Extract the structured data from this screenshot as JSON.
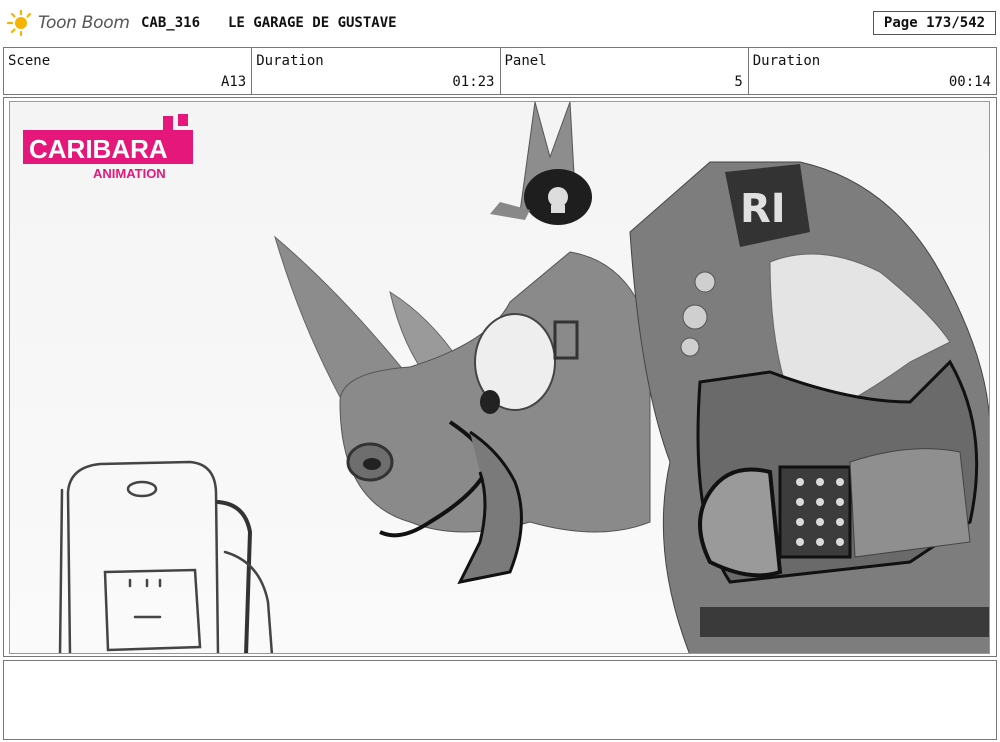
{
  "header": {
    "app_name": "Toon Boom",
    "project_code": "CAB_316",
    "title": "LE GARAGE DE GUSTAVE",
    "page": "Page 173/542"
  },
  "info": {
    "scene_label": "Scene",
    "scene_value": "A13",
    "duration1_label": "Duration",
    "duration1_value": "01:23",
    "panel_label": "Panel",
    "panel_value": "5",
    "duration2_label": "Duration",
    "duration2_value": "00:14"
  },
  "artwork": {
    "watermark_line1": "CARIBARA",
    "watermark_line2": "ANIMATION",
    "watermark_color": "#e6177a"
  },
  "notes": {
    "text": ""
  }
}
